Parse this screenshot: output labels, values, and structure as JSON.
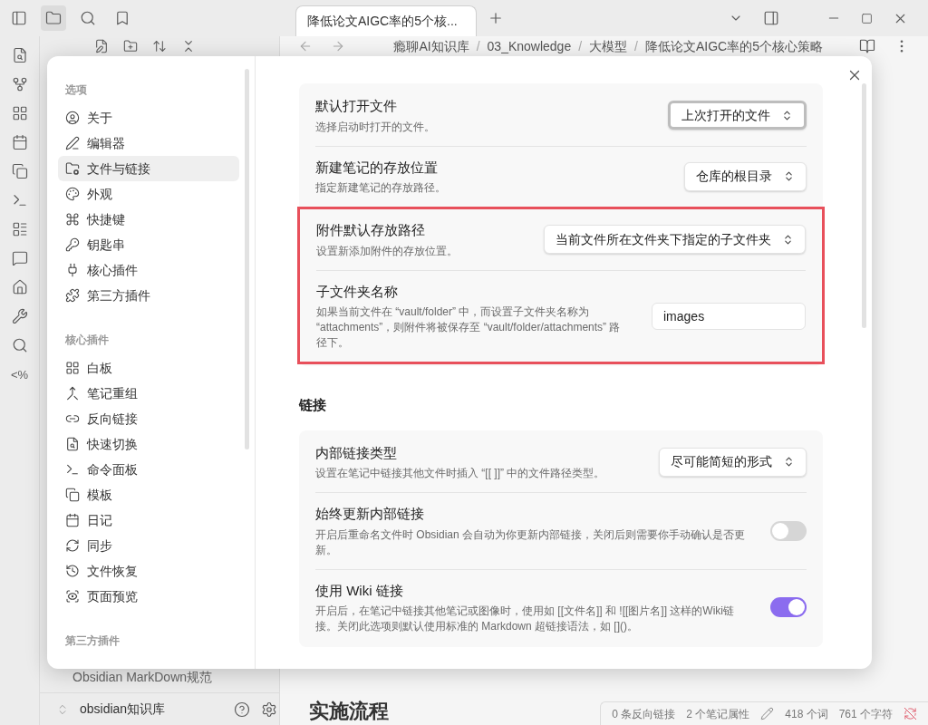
{
  "app": {
    "tabs": [
      {
        "title": "降低论文AIGC率的5个核...",
        "selected": true
      }
    ],
    "breadcrumb": [
      "瘾聊AI知识库",
      "03_Knowledge",
      "大模型",
      "降低论文AIGC率的5个核心策略"
    ],
    "breadcrumb_separator": "/",
    "ribbon_text": "<%",
    "file_item": "Obsidian MarkDown规范",
    "vault": "obsidian知识库",
    "heading": "实施流程",
    "status_bar": [
      "0 条反向链接",
      "2 个笔记属性",
      "418 个词",
      "761 个字符"
    ]
  },
  "settings": {
    "nav_sections": [
      {
        "title": "选项",
        "items": [
          {
            "label": "关于",
            "selected": false
          },
          {
            "label": "编辑器",
            "selected": false
          },
          {
            "label": "文件与链接",
            "selected": true
          },
          {
            "label": "外观",
            "selected": false
          },
          {
            "label": "快捷键",
            "selected": false
          },
          {
            "label": "钥匙串",
            "selected": false
          },
          {
            "label": "核心插件",
            "selected": false
          },
          {
            "label": "第三方插件",
            "selected": false
          }
        ]
      },
      {
        "title": "核心插件",
        "items": [
          {
            "label": "白板",
            "selected": false
          },
          {
            "label": "笔记重组",
            "selected": false
          },
          {
            "label": "反向链接",
            "selected": false
          },
          {
            "label": "快速切换",
            "selected": false
          },
          {
            "label": "命令面板",
            "selected": false
          },
          {
            "label": "模板",
            "selected": false
          },
          {
            "label": "日记",
            "selected": false
          },
          {
            "label": "同步",
            "selected": false
          },
          {
            "label": "文件恢复",
            "selected": false
          },
          {
            "label": "页面预览",
            "selected": false
          }
        ]
      },
      {
        "title": "第三方插件"
      }
    ],
    "groups": [
      {
        "settings": [
          {
            "kind": "dropdown",
            "name": "默认打开文件",
            "description": "选择启动时打开的文件。",
            "value": "上次打开的文件",
            "focused": true,
            "highlighted": false
          },
          {
            "kind": "dropdown",
            "name": "新建笔记的存放位置",
            "description": "指定新建笔记的存放路径。",
            "value": "仓库的根目录",
            "focused": false,
            "highlighted": false
          },
          {
            "kind": "dropdown",
            "name": "附件默认存放路径",
            "description": "设置新添加附件的存放位置。",
            "value": "当前文件所在文件夹下指定的子文件夹",
            "focused": false,
            "highlighted": true
          },
          {
            "kind": "text",
            "name": "子文件夹名称",
            "description": "如果当前文件在 “vault/folder” 中，而设置子文件夹名称为 “attachments”，则附件将被保存至 “vault/folder/attachments” 路径下。",
            "value": "images",
            "highlighted": true
          }
        ]
      },
      {
        "heading": "链接",
        "settings": [
          {
            "kind": "dropdown",
            "name": "内部链接类型",
            "description": "设置在笔记中链接其他文件时插入 “[[ ]]” 中的文件路径类型。",
            "value": "尽可能简短的形式",
            "focused": false,
            "highlighted": false
          },
          {
            "kind": "toggle",
            "name": "始终更新内部链接",
            "description": "开启后重命名文件时 Obsidian 会自动为你更新内部链接，关闭后则需要你手动确认是否更新。",
            "on": false,
            "highlighted": false
          },
          {
            "kind": "toggle",
            "name": "使用 Wiki 链接",
            "description": "开启后，在笔记中链接其他笔记或图像时，使用如 [[文件名]] 和 ![[图片名]] 这样的Wiki链接。关闭此选项则默认使用标准的 Markdown 超链接语法，如 []()。",
            "on": true,
            "highlighted": false
          }
        ]
      }
    ]
  }
}
